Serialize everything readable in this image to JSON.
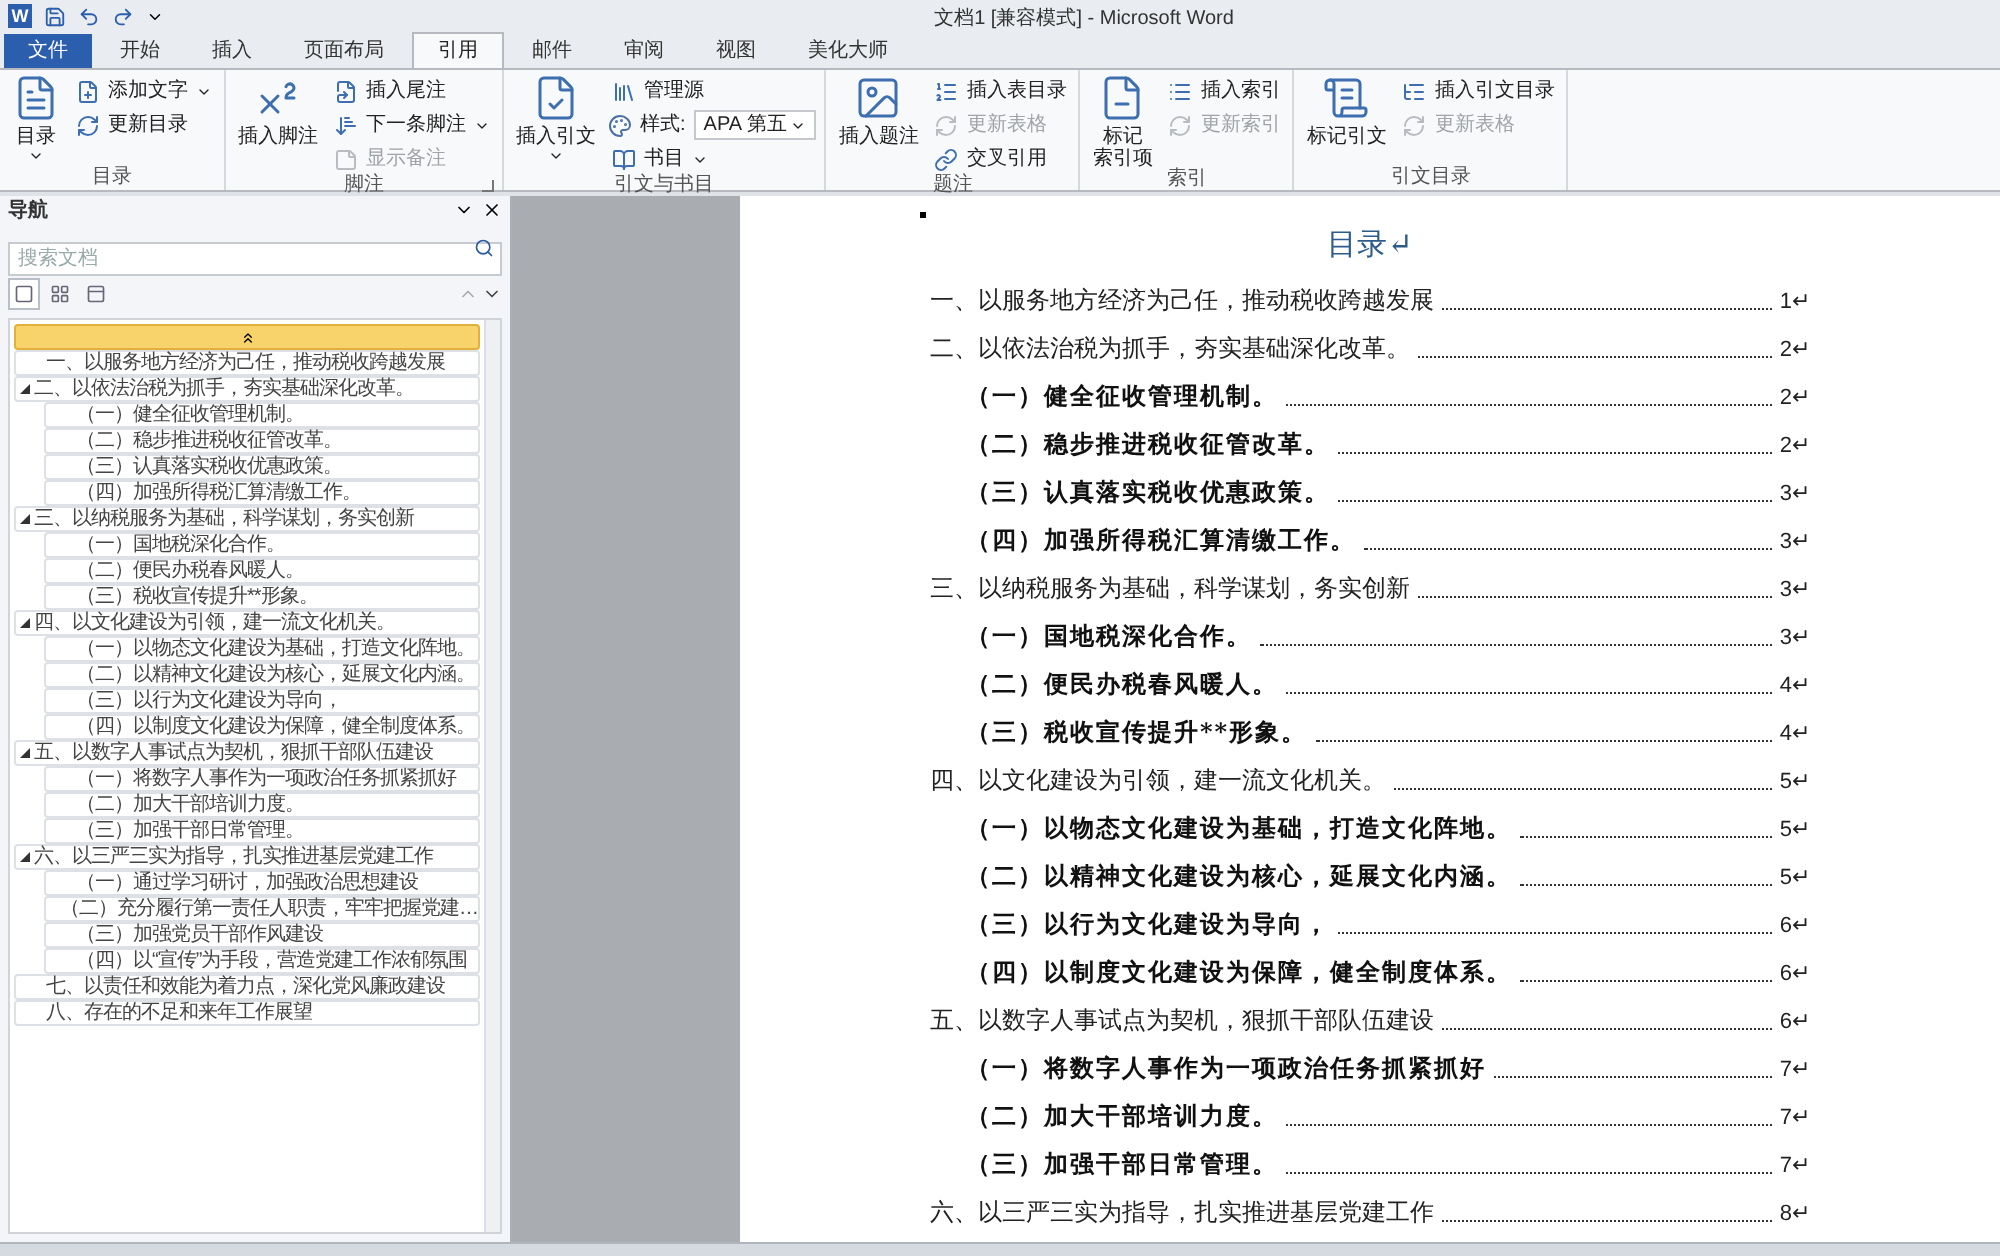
{
  "window": {
    "app_letter": "W",
    "title": "文档1 [兼容模式] - Microsoft Word"
  },
  "tabs": [
    {
      "label": "文件",
      "kind": "file",
      "selected": false
    },
    {
      "label": "开始",
      "kind": "tab",
      "selected": false
    },
    {
      "label": "插入",
      "kind": "tab",
      "selected": false
    },
    {
      "label": "页面布局",
      "kind": "tab",
      "selected": false
    },
    {
      "label": "引用",
      "kind": "tab",
      "selected": true
    },
    {
      "label": "邮件",
      "kind": "tab",
      "selected": false
    },
    {
      "label": "审阅",
      "kind": "tab",
      "selected": false
    },
    {
      "label": "视图",
      "kind": "tab",
      "selected": false
    },
    {
      "label": "美化大师",
      "kind": "tab",
      "selected": false
    }
  ],
  "ribbon": {
    "groups": [
      {
        "label": "目录",
        "launcher": false,
        "large": {
          "label": "目录",
          "dropdown": true
        },
        "items": [
          {
            "kind": "button",
            "label": "添加文字",
            "dropdown": true,
            "disabled": false
          },
          {
            "kind": "button",
            "label": "更新目录",
            "dropdown": false,
            "disabled": false
          }
        ]
      },
      {
        "label": "脚注",
        "launcher": true,
        "large": {
          "label": "插入脚注",
          "dropdown": false
        },
        "items": [
          {
            "kind": "button",
            "label": "插入尾注",
            "dropdown": false,
            "disabled": false
          },
          {
            "kind": "button",
            "label": "下一条脚注",
            "dropdown": true,
            "disabled": false
          },
          {
            "kind": "button",
            "label": "显示备注",
            "dropdown": false,
            "disabled": true
          }
        ]
      },
      {
        "label": "引文与书目",
        "launcher": false,
        "large": {
          "label": "插入引文",
          "dropdown": true
        },
        "items": [
          {
            "kind": "button",
            "label": "管理源",
            "dropdown": false,
            "disabled": false
          },
          {
            "kind": "select",
            "label": "样式:",
            "value": "APA 第五"
          },
          {
            "kind": "button",
            "label": "书目",
            "dropdown": true,
            "disabled": false
          }
        ]
      },
      {
        "label": "题注",
        "launcher": false,
        "large": {
          "label": "插入题注",
          "dropdown": false
        },
        "items": [
          {
            "kind": "button",
            "label": "插入表目录",
            "dropdown": false,
            "disabled": false
          },
          {
            "kind": "button",
            "label": "更新表格",
            "dropdown": false,
            "disabled": true
          },
          {
            "kind": "button",
            "label": "交叉引用",
            "dropdown": false,
            "disabled": false
          }
        ]
      },
      {
        "label": "索引",
        "launcher": false,
        "large": {
          "lines": [
            "标记",
            "索引项"
          ],
          "dropdown": false
        },
        "items": [
          {
            "kind": "button",
            "label": "插入索引",
            "dropdown": false,
            "disabled": false
          },
          {
            "kind": "button",
            "label": "更新索引",
            "dropdown": false,
            "disabled": true
          }
        ]
      },
      {
        "label": "引文目录",
        "launcher": false,
        "large": {
          "label": "标记引文",
          "dropdown": false
        },
        "items": [
          {
            "kind": "button",
            "label": "插入引文目录",
            "dropdown": false,
            "disabled": false
          },
          {
            "kind": "button",
            "label": "更新表格",
            "dropdown": false,
            "disabled": true
          }
        ]
      }
    ]
  },
  "navigation": {
    "title": "导航",
    "search": {
      "placeholder": "搜索文档"
    },
    "views": [
      {
        "selected": true
      },
      {
        "selected": false
      },
      {
        "selected": false
      }
    ],
    "headings": [
      {
        "text": "一、以服务地方经济为己任，推动税收跨越发展"
      },
      {
        "text": "二、以依法治税为抓手，夯实基础深化改革。",
        "expanded": true,
        "children": [
          {
            "text": "（一）健全征收管理机制。"
          },
          {
            "text": "（二）稳步推进税收征管改革。"
          },
          {
            "text": "（三）认真落实税收优惠政策。"
          },
          {
            "text": "（四）加强所得税汇算清缴工作。"
          }
        ]
      },
      {
        "text": "三、以纳税服务为基础，科学谋划，务实创新",
        "expanded": true,
        "children": [
          {
            "text": "（一）国地税深化合作。"
          },
          {
            "text": "（二）便民办税春风暖人。"
          },
          {
            "text": "（三）税收宣传提升**形象。"
          }
        ]
      },
      {
        "text": "四、以文化建设为引领，建一流文化机关。",
        "expanded": true,
        "children": [
          {
            "text": "（一）以物态文化建设为基础，打造文化阵地。"
          },
          {
            "text": "（二）以精神文化建设为核心，延展文化内涵。"
          },
          {
            "text": "（三）以行为文化建设为导向，"
          },
          {
            "text": "（四）以制度文化建设为保障，健全制度体系。"
          }
        ]
      },
      {
        "text": "五、以数字人事试点为契机，狠抓干部队伍建设",
        "expanded": true,
        "children": [
          {
            "text": "（一）将数字人事作为一项政治任务抓紧抓好"
          },
          {
            "text": "（二）加大干部培训力度。"
          },
          {
            "text": "（三）加强干部日常管理。"
          }
        ]
      },
      {
        "text": "六、以三严三实为指导，扎实推进基层党建工作",
        "expanded": true,
        "children": [
          {
            "text": "（一）通过学习研讨，加强政治思想建设"
          },
          {
            "text": "（二）充分履行第一责任人职责，牢牢把握党建…"
          },
          {
            "text": "（三）加强党员干部作风建设"
          },
          {
            "text": "（四）以“宣传”为手段，营造党建工作浓郁氛围"
          }
        ]
      },
      {
        "text": "七、以责任和效能为着力点，深化党风廉政建设"
      },
      {
        "text": "八、存在的不足和来年工作展望"
      }
    ]
  },
  "document": {
    "title": "目录↵",
    "entries": [
      {
        "text": "一、以服务地方经济为己任，推动税收跨越发展",
        "page": "1↵"
      },
      {
        "text": "二、以依法治税为抓手，夯实基础深化改革。",
        "page": "2↵",
        "children": [
          {
            "text": "（一）健全征收管理机制。",
            "page": "2↵"
          },
          {
            "text": "（二）稳步推进税收征管改革。",
            "page": "2↵"
          },
          {
            "text": "（三）认真落实税收优惠政策。",
            "page": "3↵"
          },
          {
            "text": "（四）加强所得税汇算清缴工作。",
            "page": "3↵"
          }
        ]
      },
      {
        "text": "三、以纳税服务为基础，科学谋划，务实创新",
        "page": "3↵",
        "children": [
          {
            "text": "（一）国地税深化合作。",
            "page": "3↵"
          },
          {
            "text": "（二）便民办税春风暖人。",
            "page": "4↵"
          },
          {
            "text": "（三）税收宣传提升**形象。",
            "page": "4↵"
          }
        ]
      },
      {
        "text": "四、以文化建设为引领，建一流文化机关。",
        "page": "5↵",
        "children": [
          {
            "text": "（一）以物态文化建设为基础，打造文化阵地。",
            "page": "5↵"
          },
          {
            "text": "（二）以精神文化建设为核心，延展文化内涵。",
            "page": "5↵"
          },
          {
            "text": "（三）以行为文化建设为导向，",
            "page": "6↵"
          },
          {
            "text": "（四）以制度文化建设为保障，健全制度体系。",
            "page": "6↵"
          }
        ]
      },
      {
        "text": "五、以数字人事试点为契机，狠抓干部队伍建设",
        "page": "6↵",
        "children": [
          {
            "text": "（一）将数字人事作为一项政治任务抓紧抓好",
            "page": "7↵"
          },
          {
            "text": "（二）加大干部培训力度。",
            "page": "7↵"
          },
          {
            "text": "（三）加强干部日常管理。",
            "page": "7↵"
          }
        ]
      },
      {
        "text": "六、以三严三实为指导，扎实推进基层党建工作",
        "page": "8↵"
      }
    ]
  }
}
